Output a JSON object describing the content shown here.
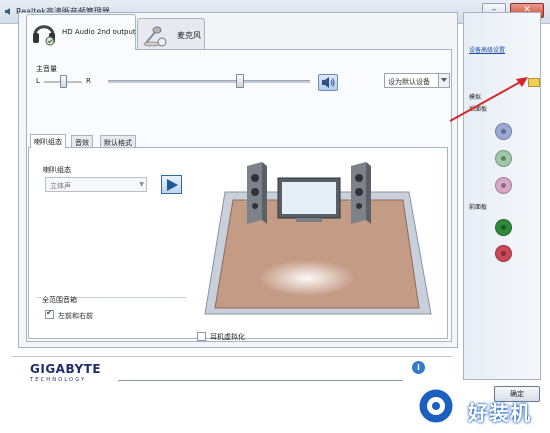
{
  "window": {
    "title": "Realtek高清晰音频管理器",
    "minimize_glyph": "–",
    "close_glyph": "✕"
  },
  "device_tabs": [
    {
      "label": "HD Audio 2nd output",
      "icon": "headphones-icon",
      "active": true
    },
    {
      "label": "麦克风",
      "icon": "microphone-icon",
      "active": false
    }
  ],
  "volume": {
    "label": "主音量",
    "left": "L",
    "right": "R",
    "balance_level": 0.5,
    "volume_level": 0.65,
    "mute_icon": "speaker-icon"
  },
  "default_device": {
    "label": "设为默认设备"
  },
  "sub_tabs": [
    {
      "label": "喇叭组态",
      "active": true
    },
    {
      "label": "音效",
      "active": false
    },
    {
      "label": "默认格式",
      "active": false
    }
  ],
  "speaker_config": {
    "label": "喇叭组态",
    "selected": "立体声",
    "play_icon": "play-icon"
  },
  "full_range": {
    "title": "全范围音箱",
    "front_lr_label": "左前和右前",
    "front_lr_checked": true
  },
  "headphone_virtualization": {
    "label": "耳机虚拟化",
    "checked": false
  },
  "side_panel": {
    "advanced_link": "设备高级设置",
    "rear_title": "模拟",
    "rear_sub": "后面板",
    "front_title": "前面板",
    "folder_icon": "folder-icon",
    "rear_jacks": [
      {
        "color": "#9aa9d6",
        "name": "rear-jack-blue"
      },
      {
        "color": "#9fc8a6",
        "name": "rear-jack-green"
      },
      {
        "color": "#d7a7c5",
        "name": "rear-jack-pink"
      }
    ],
    "front_jacks": [
      {
        "color": "#2d8a38",
        "name": "front-jack-green"
      },
      {
        "color": "#c9495a",
        "name": "front-jack-red"
      }
    ]
  },
  "footer": {
    "brand": "GIGABYTE",
    "brand_sub": "TECHNOLOGY",
    "info_glyph": "i",
    "ok_label": "确定"
  },
  "watermark": {
    "text": "好装机"
  }
}
